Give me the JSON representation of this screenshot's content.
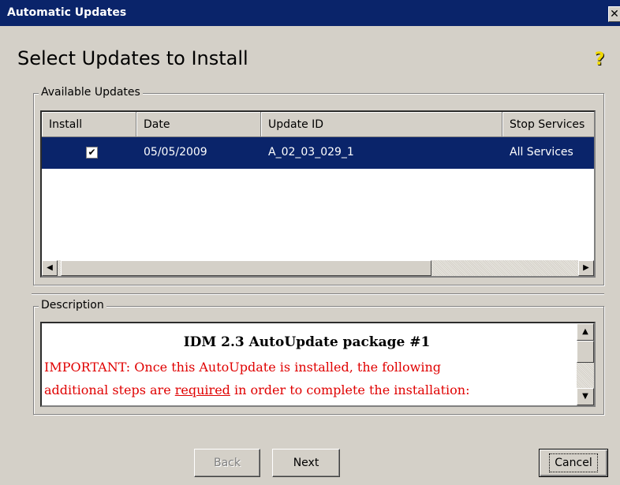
{
  "window": {
    "title": "Automatic Updates",
    "close_glyph": "✕"
  },
  "heading": "Select Updates to Install",
  "help_icon": "question-mark-icon",
  "available_updates": {
    "legend": "Available Updates",
    "columns": [
      "Install",
      "Date",
      "Update ID",
      "Stop Services"
    ],
    "rows": [
      {
        "install": true,
        "date": "05/05/2009",
        "update_id": "A_02_03_029_1",
        "stop_services": "All Services",
        "selected": true
      }
    ]
  },
  "description": {
    "legend": "Description",
    "title": "IDM 2.3 AutoUpdate package #1",
    "line1": "IMPORTANT: Once this AutoUpdate is installed, the following",
    "line2_before": "additional steps are ",
    "line2_underlined": "required",
    "line2_after": " in order to complete the installation:"
  },
  "buttons": {
    "back": "Back",
    "next": "Next",
    "cancel": "Cancel"
  },
  "colors": {
    "titlebar": "#0a246a",
    "selection": "#0a246a",
    "important_text": "#e00000",
    "face": "#d4d0c8"
  }
}
